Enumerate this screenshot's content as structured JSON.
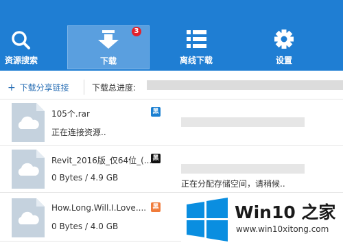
{
  "toolbar": {
    "search_label": "资源搜索",
    "download_label": "下载",
    "download_badge": "3",
    "offline_label": "离线下载",
    "settings_label": "设置"
  },
  "subbar": {
    "share_label": "下载分享链接",
    "share_plus": "+",
    "progress_label": "下载总进度:"
  },
  "downloads": [
    {
      "name": "105个.rar",
      "status": "正在连接资源..",
      "tag": "黑",
      "tag_color": "#1a7fd1"
    },
    {
      "name": "Revit_2016版_仅64位_(...",
      "status": "0 Bytes / 4.9 GB",
      "tag": "黑",
      "tag_color": "#111111",
      "note": "正在分配存储空间，请稍候.."
    },
    {
      "name": "How.Long.Will.I.Love....",
      "status": "0 Bytes / 4.0 GB",
      "tag": "黑",
      "tag_color": "#f07b3a"
    }
  ],
  "watermark": {
    "title": "Win10 之家",
    "url": "www.win10xitong.com",
    "colors": {
      "logo_blue": "#0a8ee0",
      "text": "#1a1a1a"
    }
  },
  "colors": {
    "toolbar_bg": "#1f7ed3",
    "active_tab_bg": "#5a9fdf",
    "badge": "#e3212b",
    "link": "#2a6fb5"
  }
}
